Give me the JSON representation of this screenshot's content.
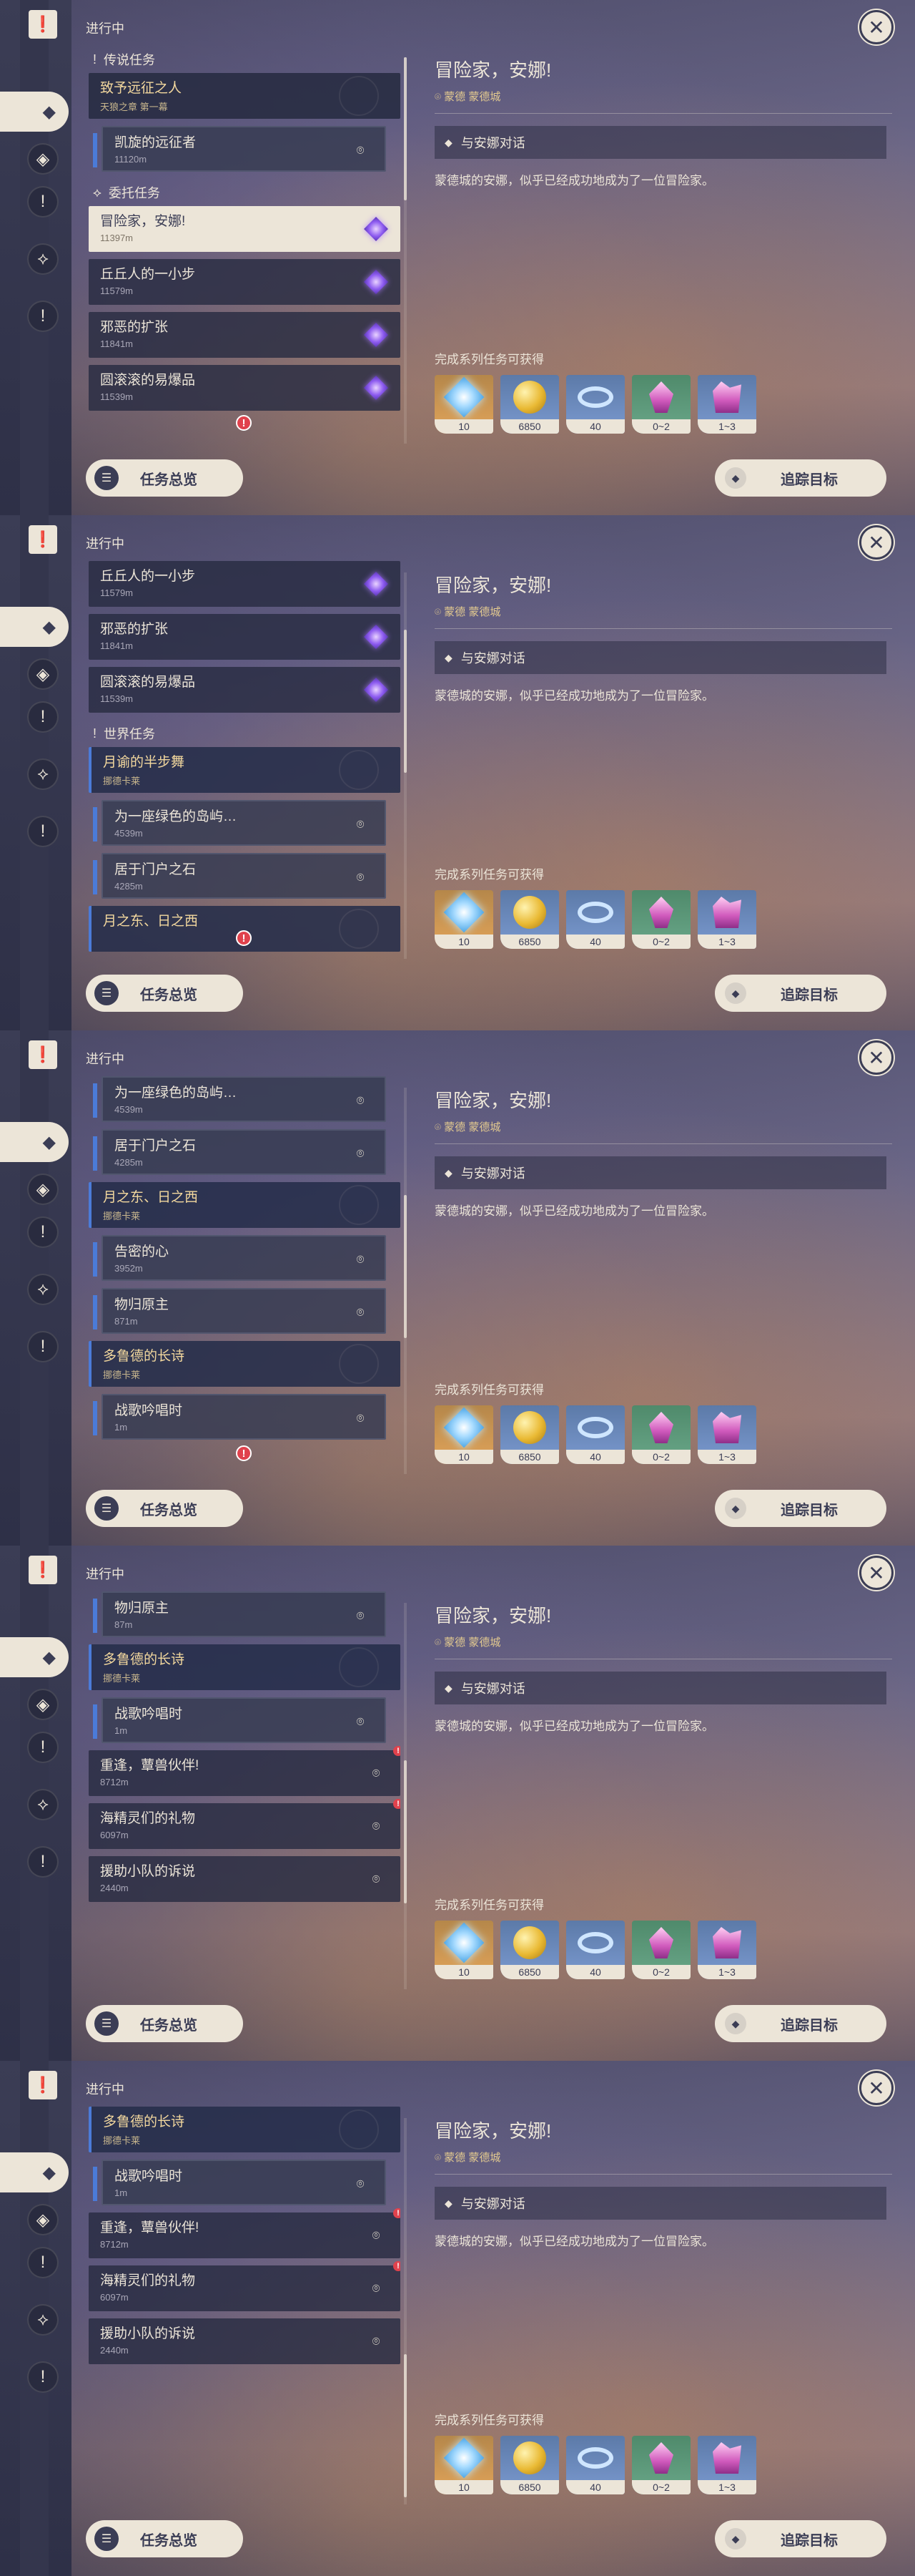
{
  "header": {
    "title": "进行中",
    "close_icon": "close-icon"
  },
  "rail": {
    "top_icon": "quest-book-icon",
    "icons": [
      "quest-category-all-icon",
      "quest-archon-icon",
      "quest-legend-icon",
      "quest-world-icon",
      "quest-commission-icon"
    ]
  },
  "detail": {
    "title": "冒险家，安娜!",
    "location": "蒙德 蒙德城",
    "objective": "与安娜对话",
    "description": "蒙德城的安娜，似乎已经成功地成为了一位冒险家。",
    "reward_label": "完成系列任务可获得",
    "rewards": [
      {
        "name": "primogem",
        "count": "10"
      },
      {
        "name": "mora",
        "count": "6850"
      },
      {
        "name": "adventure-exp",
        "count": "40"
      },
      {
        "name": "crystal-chunk",
        "count": "0~2"
      },
      {
        "name": "crystal-ore",
        "count": "1~3"
      }
    ]
  },
  "buttons": {
    "overview": "任务总览",
    "track": "追踪目标"
  },
  "frames": [
    {
      "items": [
        {
          "kind": "section",
          "symbol": "!",
          "label": "传说任务"
        },
        {
          "kind": "legend",
          "name": "致予远征之人",
          "sub": "天狼之章 第一幕"
        },
        {
          "kind": "sub",
          "name": "凯旋的远征者",
          "sub": "11120m",
          "icon": "pin"
        },
        {
          "kind": "section",
          "symbol": "⟡",
          "label": "委托任务"
        },
        {
          "kind": "selected",
          "name": "冒险家，安娜!",
          "sub": "11397m",
          "icon": "star"
        },
        {
          "kind": "plain",
          "name": "丘丘人的一小步",
          "sub": "11579m",
          "icon": "star"
        },
        {
          "kind": "plain",
          "name": "邪恶的扩张",
          "sub": "11841m",
          "icon": "star"
        },
        {
          "kind": "plain",
          "name": "圆滚滚的易爆品",
          "sub": "11539m",
          "icon": "star"
        }
      ]
    },
    {
      "items": [
        {
          "kind": "plain",
          "name": "丘丘人的一小步",
          "sub": "11579m",
          "icon": "star"
        },
        {
          "kind": "plain",
          "name": "邪恶的扩张",
          "sub": "11841m",
          "icon": "star"
        },
        {
          "kind": "plain",
          "name": "圆滚滚的易爆品",
          "sub": "11539m",
          "icon": "star"
        },
        {
          "kind": "section",
          "symbol": "!",
          "label": "世界任务"
        },
        {
          "kind": "parent",
          "name": "月谕的半步舞",
          "sub": "挪德卡莱"
        },
        {
          "kind": "sub",
          "name": "为一座绿色的岛屿…",
          "sub": "4539m",
          "icon": "pin"
        },
        {
          "kind": "sub",
          "name": "居于门户之石",
          "sub": "4285m",
          "icon": "pin"
        },
        {
          "kind": "parent",
          "name": "月之东、日之西",
          "sub": ""
        }
      ]
    },
    {
      "items": [
        {
          "kind": "sub",
          "name": "为一座绿色的岛屿…",
          "sub": "4539m",
          "icon": "pin"
        },
        {
          "kind": "sub",
          "name": "居于门户之石",
          "sub": "4285m",
          "icon": "pin"
        },
        {
          "kind": "parent",
          "name": "月之东、日之西",
          "sub": "挪德卡莱"
        },
        {
          "kind": "sub",
          "name": "告密的心",
          "sub": "3952m",
          "icon": "pin"
        },
        {
          "kind": "sub",
          "name": "物归原主",
          "sub": "871m",
          "icon": "pin"
        },
        {
          "kind": "parent",
          "name": "多鲁德的长诗",
          "sub": "挪德卡莱"
        },
        {
          "kind": "sub",
          "name": "战歌吟唱时",
          "sub": "1m",
          "icon": "pin"
        }
      ]
    },
    {
      "items": [
        {
          "kind": "sub",
          "name": "物归原主",
          "sub": "87m",
          "icon": "pin"
        },
        {
          "kind": "parent",
          "name": "多鲁德的长诗",
          "sub": "挪德卡莱"
        },
        {
          "kind": "sub",
          "name": "战歌吟唱时",
          "sub": "1m",
          "icon": "pin"
        },
        {
          "kind": "plain",
          "name": "重逢，蕈兽伙伴!",
          "sub": "8712m",
          "icon": "pin",
          "alert": true
        },
        {
          "kind": "plain",
          "name": "海精灵们的礼物",
          "sub": "6097m",
          "icon": "pin",
          "alert": true
        },
        {
          "kind": "plain",
          "name": "援助小队的诉说",
          "sub": "2440m",
          "icon": "pin"
        }
      ]
    },
    {
      "items": [
        {
          "kind": "parent",
          "name": "多鲁德的长诗",
          "sub": "挪德卡莱"
        },
        {
          "kind": "sub",
          "name": "战歌吟唱时",
          "sub": "1m",
          "icon": "pin"
        },
        {
          "kind": "plain",
          "name": "重逢，蕈兽伙伴!",
          "sub": "8712m",
          "icon": "pin",
          "alert": true
        },
        {
          "kind": "plain",
          "name": "海精灵们的礼物",
          "sub": "6097m",
          "icon": "pin",
          "alert": true
        },
        {
          "kind": "plain",
          "name": "援助小队的诉说",
          "sub": "2440m",
          "icon": "pin"
        }
      ]
    }
  ],
  "bottom_alerts": [
    "!",
    "!",
    "!"
  ]
}
